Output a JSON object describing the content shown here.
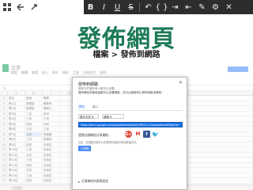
{
  "toolbar": {
    "left_icons": [
      "grid-icon",
      "back-icon",
      "fullscreen-icon"
    ],
    "format_buttons": [
      "B",
      "I",
      "U",
      "S"
    ],
    "extra_icons": [
      "undo-icon",
      "braces-icon",
      "indent-icon",
      "outdent-icon",
      "pencil-icon",
      "gear-icon",
      "close-icon"
    ]
  },
  "headline": {
    "title": "發佈網頁",
    "path": "檔案 > 發佈到網路"
  },
  "sheet": {
    "doc_title": "三字",
    "menu": [
      "檔案",
      "編輯",
      "查看",
      "插入",
      "格式",
      "資料",
      "工具",
      "外掛程式",
      "說明"
    ],
    "column_headers": [
      "",
      "A",
      "B",
      "C",
      "D",
      "E"
    ],
    "rows": [
      [
        "1",
        "姓名",
        "班級",
        "職業"
      ],
      [
        "2",
        "蔡1位",
        "經理部",
        "職業甲"
      ],
      [
        "3",
        "蔡2位",
        "經理部",
        "職業乙"
      ],
      [
        "4",
        "蔡3位",
        "二班",
        "甲班"
      ],
      [
        "5",
        "蔡4位",
        "三班",
        "乙班"
      ],
      [
        "6",
        "蔡5位",
        "四班",
        "甲班"
      ],
      [
        "7",
        "蔡6位",
        "五班",
        "乙班"
      ],
      [
        "8",
        "蔡7位",
        "五班",
        "長機器"
      ],
      [
        "9",
        "蔡8位",
        "三班",
        "經理部"
      ],
      [
        "10",
        "蔡9位",
        "四班",
        "未設定"
      ],
      [
        "11",
        "蔡10位",
        "三班",
        "未設定"
      ],
      [
        "12",
        "蔡11位",
        "五班",
        "未設定"
      ],
      [
        "13",
        "蔡12位",
        "三班",
        "未設定"
      ],
      [
        "14",
        "蔡13位",
        "四班",
        "未設定"
      ],
      [
        "15",
        "蔡14位",
        "五班",
        "未設定"
      ],
      [
        "16",
        "蔡15位",
        "三班",
        "未設定"
      ],
      [
        "17",
        "蔡16位",
        "四班",
        "未設定"
      ]
    ]
  },
  "dialog": {
    "title": "發佈到網路",
    "description1": "發佈文件讓所有人都可以查看。",
    "description2": "擁有網址的使用者都可以查看網頁，您可以隨時停止發佈或取消發佈。",
    "tab_link": "連結",
    "tab_embed": "嵌入",
    "select_sheet": "整份文件",
    "select_format": "網頁",
    "url": "https://docs.google.com/spreadsheets/d/e/2PACX-1vSpreadsheetPubhtml",
    "share_label": "透過社群網站分享連結：",
    "social_icons": [
      "google-plus-icon",
      "gmail-icon",
      "facebook-icon",
      "twitter-icon"
    ],
    "hint": "注意：檢視者可能可以在發佈的頁面中看到原始文件。",
    "done_label": "已發佈",
    "auto_option": "已發佈的內容與設定"
  }
}
